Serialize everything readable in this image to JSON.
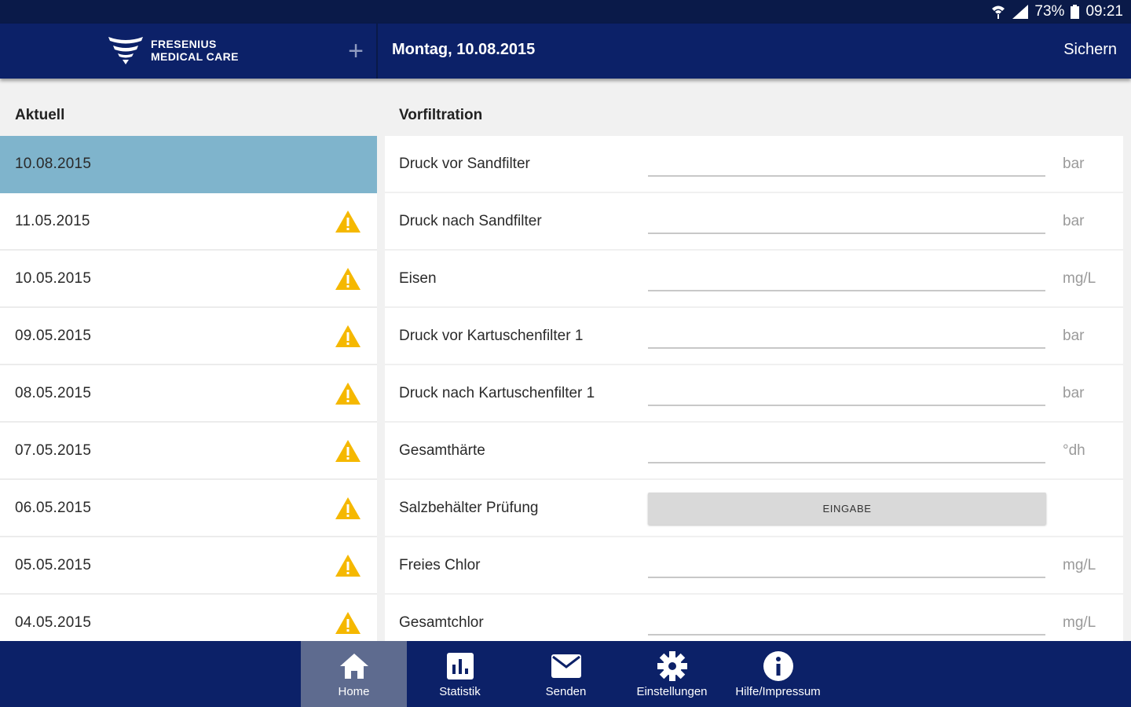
{
  "status_bar": {
    "battery": "73%",
    "time": "09:21"
  },
  "header": {
    "logo_line1": "FRESENIUS",
    "logo_line2": "MEDICAL CARE",
    "add_label": "+",
    "date": "Montag, 10.08.2015",
    "save_label": "Sichern"
  },
  "left": {
    "section_title": "Aktuell",
    "dates": [
      {
        "date": "10.08.2015",
        "selected": true,
        "warning": false
      },
      {
        "date": "11.05.2015",
        "selected": false,
        "warning": true
      },
      {
        "date": "10.05.2015",
        "selected": false,
        "warning": true
      },
      {
        "date": "09.05.2015",
        "selected": false,
        "warning": true
      },
      {
        "date": "08.05.2015",
        "selected": false,
        "warning": true
      },
      {
        "date": "07.05.2015",
        "selected": false,
        "warning": true
      },
      {
        "date": "06.05.2015",
        "selected": false,
        "warning": true
      },
      {
        "date": "05.05.2015",
        "selected": false,
        "warning": true
      },
      {
        "date": "04.05.2015",
        "selected": false,
        "warning": true
      }
    ]
  },
  "right": {
    "section_title": "Vorfiltration",
    "fields": [
      {
        "label": "Druck vor Sandfilter",
        "unit": "bar"
      },
      {
        "label": "Druck nach Sandfilter",
        "unit": "bar"
      },
      {
        "label": "Eisen",
        "unit": "mg/L"
      },
      {
        "label": "Druck vor Kartuschenfilter 1",
        "unit": "bar"
      },
      {
        "label": "Druck nach Kartuschenfilter 1",
        "unit": "bar"
      },
      {
        "label": "Gesamthärte",
        "unit": "°dh"
      },
      {
        "label": "Salzbehälter Prüfung",
        "button": "EINGABE"
      },
      {
        "label": "Freies Chlor",
        "unit": "mg/L"
      },
      {
        "label": "Gesamtchlor",
        "unit": "mg/L"
      }
    ]
  },
  "nav": {
    "items": [
      {
        "label": "Home",
        "icon": "home-icon",
        "active": true
      },
      {
        "label": "Statistik",
        "icon": "chart-icon",
        "active": false
      },
      {
        "label": "Senden",
        "icon": "mail-icon",
        "active": false
      },
      {
        "label": "Einstellungen",
        "icon": "gear-icon",
        "active": false
      },
      {
        "label": "Hilfe/Impressum",
        "icon": "info-icon",
        "active": false
      }
    ]
  },
  "colors": {
    "header": "#0c2168",
    "statusbar": "#0a1a49",
    "selected_row": "#7fb4cc",
    "warning": "#f5b800",
    "nav_active": "#5e6b8f"
  }
}
